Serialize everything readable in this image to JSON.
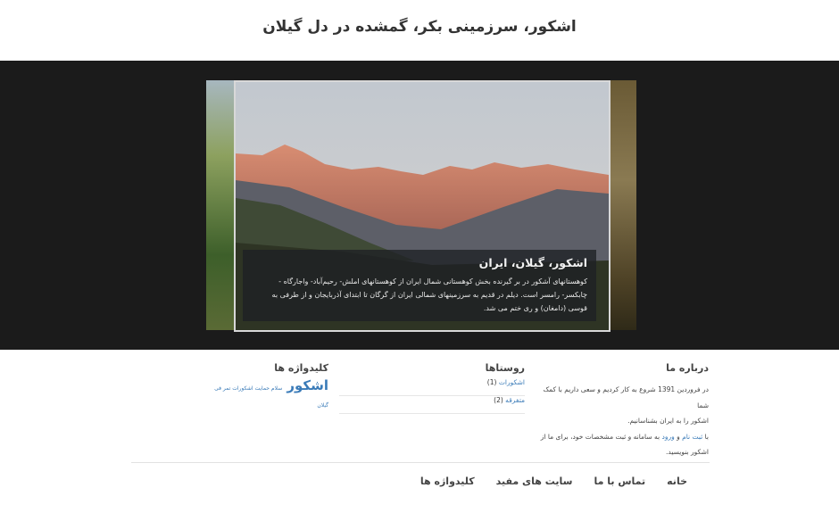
{
  "site": {
    "title": "اشکور، سرزمینی بکر، گمشده در دل گیلان"
  },
  "slider": {
    "caption_title": "اشکور، گیلان، ایران",
    "caption_text": "کوهستانهای آشکور در بر گیرنده بخش کوهستانی شمال ایران از کوهستانهای املش- رحیم‌آباد- واجارگاه - چابکسر- رامسر است. دیلم در قدیم به سرزمینهای شمالی ایران از گرگان تا ابتدای آذربایجان و از طرفی به قوسی (دامغان) و ری ختم می شد."
  },
  "about": {
    "heading": "درباره ما",
    "line1": "در فروردین 1391 شروع به کار کردیم و سعی داریم با کمک شما",
    "line2": "اشکور را به ایران بشناسانیم.",
    "line3_prefix": "با",
    "register_link": "ثبت نام",
    "and": "و",
    "login_link": "ورود",
    "line3_suffix": "به سامانه و ثبت مشخصات خود، برای ما از",
    "line4": "اشکور بنویسید."
  },
  "villages": {
    "heading": "روستاها",
    "items": [
      {
        "name": "اشکورات",
        "count": "(1)"
      },
      {
        "name": "متفرقه",
        "count": "(2)"
      }
    ]
  },
  "tags": {
    "heading": "کلیدواژه ها",
    "big": "اشکور",
    "small": "سلام حمایت اشکورات تمر فی گیلان"
  },
  "footer_nav": [
    "خانه",
    "تماس با ما",
    "سایت های مفید",
    "کلیدواژه ها"
  ],
  "colors": {
    "link": "#3a7bb8",
    "slider_bg": "#1b1b1b"
  }
}
